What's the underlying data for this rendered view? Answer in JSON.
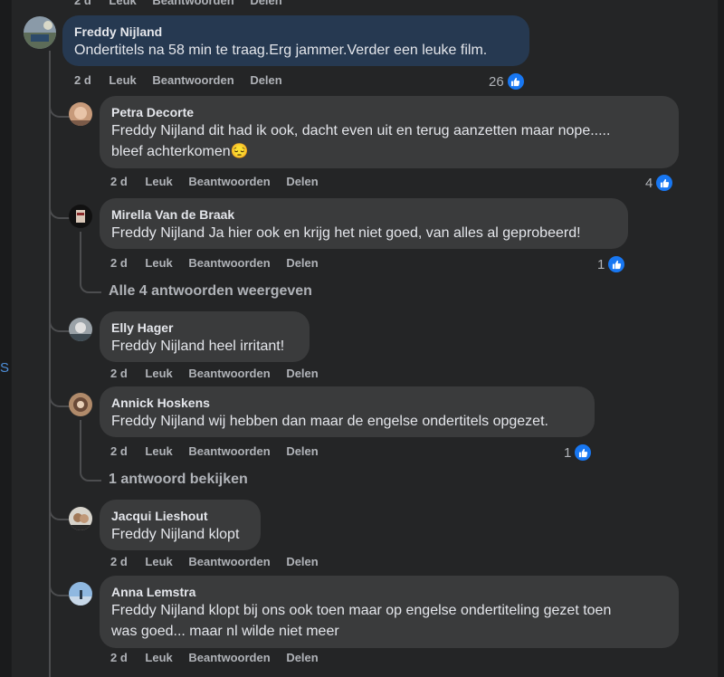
{
  "actions": {
    "age": "2 d",
    "like": "Leuk",
    "reply": "Beantwoorden",
    "share": "Delen"
  },
  "top_fragment": {
    "age": "2 d",
    "like": "Leuk",
    "reply": "Beantwoorden",
    "share": "Delen"
  },
  "main_comment": {
    "author": "Freddy Nijland",
    "text": "Ondertitels na 58 min te traag.Erg jammer.Verder een leuke film.",
    "reactions": "26"
  },
  "replies": [
    {
      "author": "Petra Decorte",
      "line1": "Freddy Nijland dit had ik ook, dacht even uit en terug aanzetten maar nope.....",
      "line2": "bleef achterkomen😔",
      "reactions": "4"
    },
    {
      "author": "Mirella Van de Braak",
      "text": "Freddy Nijland Ja hier ook en krijg het niet goed, van alles al geprobeerd!",
      "reactions": "1",
      "more": "Alle 4 antwoorden weergeven"
    },
    {
      "author": "Elly Hager",
      "text": "Freddy Nijland heel irritant!"
    },
    {
      "author": "Annick Hoskens",
      "text": "Freddy Nijland wij hebben dan maar de engelse ondertitels opgezet.",
      "reactions": "1",
      "more": "1 antwoord bekijken"
    },
    {
      "author": "Jacqui Lieshout",
      "text": "Freddy Nijland klopt"
    },
    {
      "author": "Anna Lemstra",
      "line1": "Freddy Nijland klopt bij ons ook toen maar op engelse ondertiteling gezet toen",
      "line2": "was goed... maar nl wilde niet meer"
    }
  ],
  "colors": {
    "accent": "#1877f2",
    "bubble": "#3a3b3c",
    "highlight_bubble": "#263951"
  }
}
